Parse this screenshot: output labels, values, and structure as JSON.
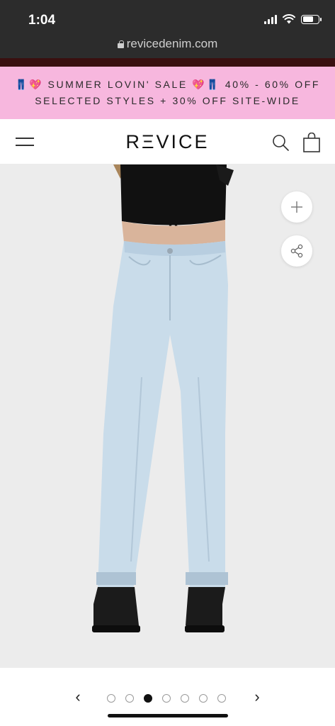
{
  "status_bar": {
    "time": "1:04"
  },
  "browser": {
    "url": "revicedenim.com"
  },
  "announcement": {
    "line1": "👖💖 SUMMER LOVIN' SALE 💖👖 40% - 60% OFF",
    "line2": "SELECTED STYLES + 30% OFF SITE-WIDE"
  },
  "header": {
    "logo": "RΞVICE",
    "menu_icon": "hamburger-menu-icon",
    "search_icon": "search-icon",
    "cart_icon": "shopping-bag-icon"
  },
  "product_image": {
    "alt_subject": "light wash straight leg jeans with black crop top and boots",
    "zoom_icon": "plus-icon",
    "share_icon": "share-icon"
  },
  "gallery": {
    "prev_label": "‹",
    "next_label": "›",
    "total_slides": 7,
    "active_index": 2
  },
  "colors": {
    "announcement_bg": "#f7b7de",
    "denim": "#c9dcea",
    "top": "#111111"
  }
}
